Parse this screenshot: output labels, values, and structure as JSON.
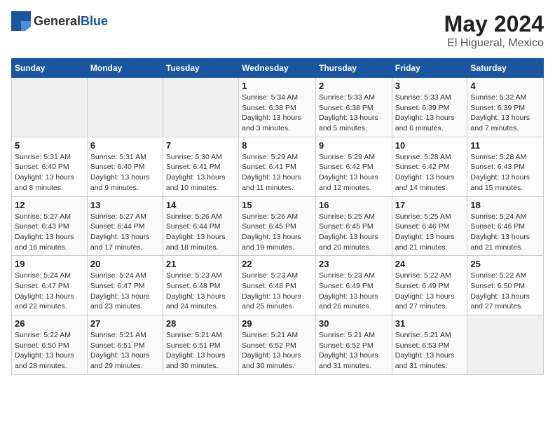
{
  "header": {
    "logo_general": "General",
    "logo_blue": "Blue",
    "month": "May 2024",
    "location": "El Higueral, Mexico"
  },
  "days_of_week": [
    "Sunday",
    "Monday",
    "Tuesday",
    "Wednesday",
    "Thursday",
    "Friday",
    "Saturday"
  ],
  "weeks": [
    [
      {
        "day": "",
        "info": ""
      },
      {
        "day": "",
        "info": ""
      },
      {
        "day": "",
        "info": ""
      },
      {
        "day": "1",
        "info": "Sunrise: 5:34 AM\nSunset: 6:38 PM\nDaylight: 13 hours and 3 minutes."
      },
      {
        "day": "2",
        "info": "Sunrise: 5:33 AM\nSunset: 6:38 PM\nDaylight: 13 hours and 5 minutes."
      },
      {
        "day": "3",
        "info": "Sunrise: 5:33 AM\nSunset: 6:39 PM\nDaylight: 13 hours and 6 minutes."
      },
      {
        "day": "4",
        "info": "Sunrise: 5:32 AM\nSunset: 6:39 PM\nDaylight: 13 hours and 7 minutes."
      }
    ],
    [
      {
        "day": "5",
        "info": "Sunrise: 5:31 AM\nSunset: 6:40 PM\nDaylight: 13 hours and 8 minutes."
      },
      {
        "day": "6",
        "info": "Sunrise: 5:31 AM\nSunset: 6:40 PM\nDaylight: 13 hours and 9 minutes."
      },
      {
        "day": "7",
        "info": "Sunrise: 5:30 AM\nSunset: 6:41 PM\nDaylight: 13 hours and 10 minutes."
      },
      {
        "day": "8",
        "info": "Sunrise: 5:29 AM\nSunset: 6:41 PM\nDaylight: 13 hours and 11 minutes."
      },
      {
        "day": "9",
        "info": "Sunrise: 5:29 AM\nSunset: 6:42 PM\nDaylight: 13 hours and 12 minutes."
      },
      {
        "day": "10",
        "info": "Sunrise: 5:28 AM\nSunset: 6:42 PM\nDaylight: 13 hours and 14 minutes."
      },
      {
        "day": "11",
        "info": "Sunrise: 5:28 AM\nSunset: 6:43 PM\nDaylight: 13 hours and 15 minutes."
      }
    ],
    [
      {
        "day": "12",
        "info": "Sunrise: 5:27 AM\nSunset: 6:43 PM\nDaylight: 13 hours and 16 minutes."
      },
      {
        "day": "13",
        "info": "Sunrise: 5:27 AM\nSunset: 6:44 PM\nDaylight: 13 hours and 17 minutes."
      },
      {
        "day": "14",
        "info": "Sunrise: 5:26 AM\nSunset: 6:44 PM\nDaylight: 13 hours and 18 minutes."
      },
      {
        "day": "15",
        "info": "Sunrise: 5:26 AM\nSunset: 6:45 PM\nDaylight: 13 hours and 19 minutes."
      },
      {
        "day": "16",
        "info": "Sunrise: 5:25 AM\nSunset: 6:45 PM\nDaylight: 13 hours and 20 minutes."
      },
      {
        "day": "17",
        "info": "Sunrise: 5:25 AM\nSunset: 6:46 PM\nDaylight: 13 hours and 21 minutes."
      },
      {
        "day": "18",
        "info": "Sunrise: 5:24 AM\nSunset: 6:46 PM\nDaylight: 13 hours and 21 minutes."
      }
    ],
    [
      {
        "day": "19",
        "info": "Sunrise: 5:24 AM\nSunset: 6:47 PM\nDaylight: 13 hours and 22 minutes."
      },
      {
        "day": "20",
        "info": "Sunrise: 5:24 AM\nSunset: 6:47 PM\nDaylight: 13 hours and 23 minutes."
      },
      {
        "day": "21",
        "info": "Sunrise: 5:23 AM\nSunset: 6:48 PM\nDaylight: 13 hours and 24 minutes."
      },
      {
        "day": "22",
        "info": "Sunrise: 5:23 AM\nSunset: 6:48 PM\nDaylight: 13 hours and 25 minutes."
      },
      {
        "day": "23",
        "info": "Sunrise: 5:23 AM\nSunset: 6:49 PM\nDaylight: 13 hours and 26 minutes."
      },
      {
        "day": "24",
        "info": "Sunrise: 5:22 AM\nSunset: 6:49 PM\nDaylight: 13 hours and 27 minutes."
      },
      {
        "day": "25",
        "info": "Sunrise: 5:22 AM\nSunset: 6:50 PM\nDaylight: 13 hours and 27 minutes."
      }
    ],
    [
      {
        "day": "26",
        "info": "Sunrise: 5:22 AM\nSunset: 6:50 PM\nDaylight: 13 hours and 28 minutes."
      },
      {
        "day": "27",
        "info": "Sunrise: 5:21 AM\nSunset: 6:51 PM\nDaylight: 13 hours and 29 minutes."
      },
      {
        "day": "28",
        "info": "Sunrise: 5:21 AM\nSunset: 6:51 PM\nDaylight: 13 hours and 30 minutes."
      },
      {
        "day": "29",
        "info": "Sunrise: 5:21 AM\nSunset: 6:52 PM\nDaylight: 13 hours and 30 minutes."
      },
      {
        "day": "30",
        "info": "Sunrise: 5:21 AM\nSunset: 6:52 PM\nDaylight: 13 hours and 31 minutes."
      },
      {
        "day": "31",
        "info": "Sunrise: 5:21 AM\nSunset: 6:53 PM\nDaylight: 13 hours and 31 minutes."
      },
      {
        "day": "",
        "info": ""
      }
    ]
  ]
}
